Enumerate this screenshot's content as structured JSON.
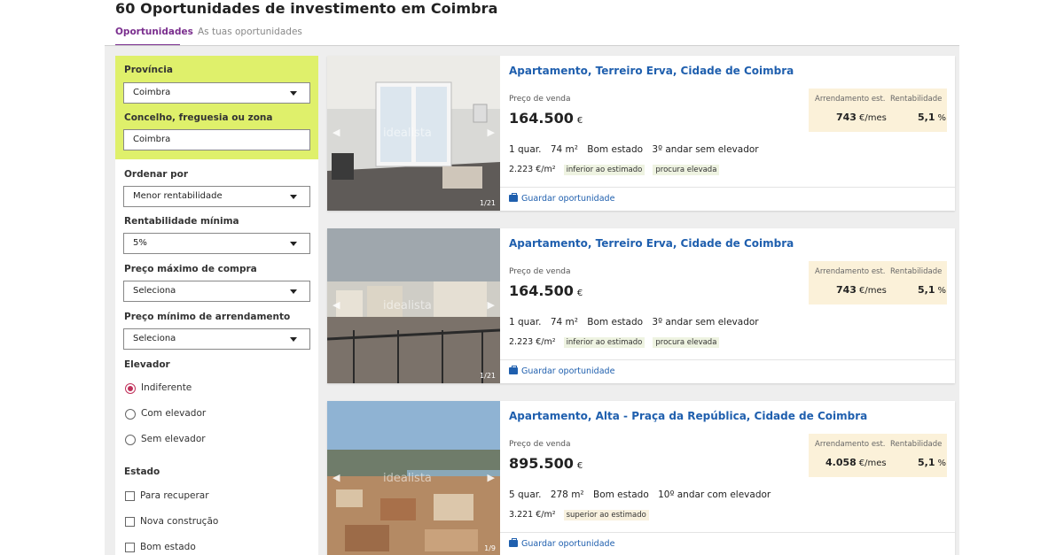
{
  "page": {
    "title": "60 Oportunidades de investimento em Coimbra"
  },
  "tabs": [
    {
      "label": "Oportunidades",
      "active": true
    },
    {
      "label": "As tuas oportunidades",
      "active": false
    }
  ],
  "filters": {
    "provincia": {
      "label": "Província",
      "value": "Coimbra"
    },
    "concelho": {
      "label": "Concelho, freguesia ou zona",
      "value": "Coimbra"
    },
    "ordenar": {
      "label": "Ordenar por",
      "value": "Menor rentabilidade"
    },
    "rent_min": {
      "label": "Rentabilidade mínima",
      "value": "5%"
    },
    "preco_max": {
      "label": "Preço máximo de compra",
      "value": "Seleciona"
    },
    "arrend_min": {
      "label": "Preço mínimo de arrendamento",
      "value": "Seleciona"
    },
    "elevador": {
      "label": "Elevador",
      "options": [
        "Indiferente",
        "Com elevador",
        "Sem elevador"
      ],
      "selected": "Indiferente"
    },
    "estado": {
      "label": "Estado",
      "options": [
        "Para recuperar",
        "Nova construção",
        "Bom estado"
      ]
    }
  },
  "listings": [
    {
      "title": "Apartamento, Terreiro Erva, Cidade de Coimbra",
      "price_label": "Preço de venda",
      "price": "164.500",
      "currency": "€",
      "features": [
        "1 quar.",
        "74 m²",
        "Bom estado",
        "3º andar sem elevador"
      ],
      "price_sqm": "2.223 €/m²",
      "tags": [
        "inferior ao estimado",
        "procura elevada"
      ],
      "rent_label": "Arrendamento est.",
      "rent_value": "743",
      "rent_unit": "€/mes",
      "yield_label": "Rentabilidade",
      "yield_value": "5,1",
      "yield_unit": "%",
      "photo_counter": "1/21",
      "watermark": "idealista",
      "save_label": "Guardar oportunidade"
    },
    {
      "title": "Apartamento, Terreiro Erva, Cidade de Coimbra",
      "price_label": "Preço de venda",
      "price": "164.500",
      "currency": "€",
      "features": [
        "1 quar.",
        "74 m²",
        "Bom estado",
        "3º andar sem elevador"
      ],
      "price_sqm": "2.223 €/m²",
      "tags": [
        "inferior ao estimado",
        "procura elevada"
      ],
      "rent_label": "Arrendamento est.",
      "rent_value": "743",
      "rent_unit": "€/mes",
      "yield_label": "Rentabilidade",
      "yield_value": "5,1",
      "yield_unit": "%",
      "photo_counter": "1/21",
      "watermark": "idealista",
      "save_label": "Guardar oportunidade"
    },
    {
      "title": "Apartamento, Alta - Praça da República, Cidade de Coimbra",
      "price_label": "Preço de venda",
      "price": "895.500",
      "currency": "€",
      "features": [
        "5 quar.",
        "278 m²",
        "Bom estado",
        "10º andar com elevador"
      ],
      "price_sqm": "3.221 €/m²",
      "tags": [
        "superior ao estimado"
      ],
      "rent_label": "Arrendamento est.",
      "rent_value": "4.058",
      "rent_unit": "€/mes",
      "yield_label": "Rentabilidade",
      "yield_value": "5,1",
      "yield_unit": "%",
      "photo_counter": "1/9",
      "watermark": "idealista",
      "save_label": "Guardar oportunidade"
    }
  ]
}
